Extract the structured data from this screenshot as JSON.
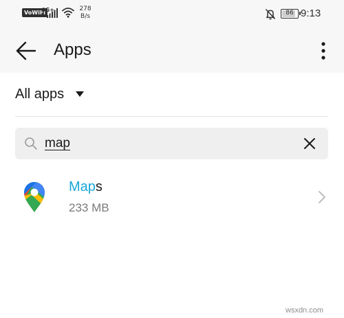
{
  "status_bar": {
    "wifi_badge": "VoWiFi",
    "network_type": "4G+",
    "speed_value": "278",
    "speed_unit": "B/s",
    "battery_level": "86",
    "time": "9:13"
  },
  "app_bar": {
    "title": "Apps",
    "back_icon": "arrow-left-icon",
    "more_icon": "more-vertical-icon"
  },
  "filter": {
    "label": "All apps",
    "caret_icon": "caret-down-icon"
  },
  "search": {
    "value": "map",
    "search_icon": "search-icon",
    "clear_icon": "close-icon"
  },
  "results": [
    {
      "name_match": "Map",
      "name_rest": "s",
      "size": "233 MB",
      "icon": "google-maps-pin-icon"
    }
  ],
  "colors": {
    "highlight": "#1aa7d8",
    "bar_background": "#f7f7f7",
    "search_background": "#efefef"
  },
  "watermark": "wsxdn.com"
}
